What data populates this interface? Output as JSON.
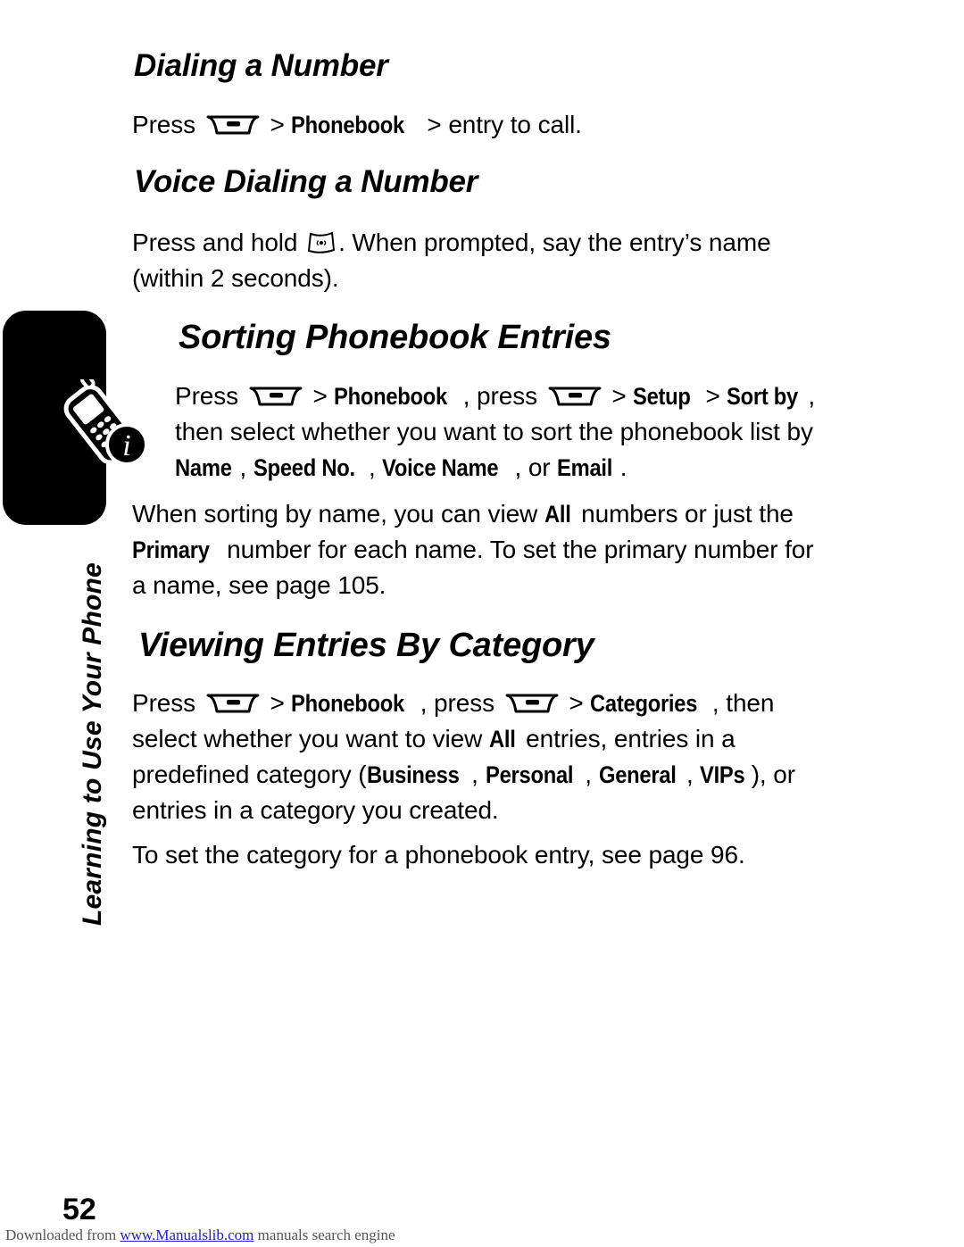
{
  "chapter": {
    "title": "Learning to Use Your Phone",
    "icon": "phone-info-icon"
  },
  "sections": [
    {
      "id": "dialing",
      "heading": "Dialing a Number",
      "paragraph": {
        "pre": "Press ",
        "key1": "menu-key-icon",
        "mid1": " > ",
        "ui1": "Phonebook",
        "mid2": " > entry to call.",
        "post": ""
      }
    },
    {
      "id": "voice-dialing",
      "heading": "Voice Dialing a Number",
      "paragraph": {
        "pre": "Press and hold ",
        "key1": "voice-key-icon",
        "post": ". When prompted, say the entry’s name (within 2 seconds)."
      }
    },
    {
      "id": "sorting",
      "heading": "Sorting Phonebook Entries",
      "paragraph": {
        "pre": "Press ",
        "key1": "menu-key-icon",
        "mid1": " > ",
        "ui1": "Phonebook",
        "mid2": ", press ",
        "key2": "menu-key-icon",
        "mid3": " > ",
        "ui2": "Setup",
        "mid4": " > ",
        "ui3": "Sort by",
        "mid5": ", then select whether you want to sort the phonebook list by ",
        "ui4": "Name",
        "mid6": ", ",
        "ui5": "Speed No.",
        "mid7": ", ",
        "ui6": "Voice Name",
        "mid8": ", or ",
        "ui7": "Email",
        "post": "."
      },
      "paragraph2": {
        "pre": "When sorting by name, you can view ",
        "ui1": "All",
        "mid1": " numbers or just the ",
        "ui2": "Primary",
        "post": " number for each name. To set the primary number for a name, see page 105."
      }
    },
    {
      "id": "viewing",
      "heading": "Viewing Entries By Category",
      "paragraph": {
        "pre": "Press ",
        "key1": "menu-key-icon",
        "mid1": " > ",
        "ui1": "Phonebook",
        "mid2": ", press ",
        "key2": "menu-key-icon",
        "mid3": " > ",
        "ui2": "Categories",
        "mid4": ", then select whether you want to view ",
        "ui3": "All",
        "mid5": " entries, entries in a predefined category (",
        "ui4": "Business",
        "mid6": ", ",
        "ui5": "Personal",
        "mid7": ", ",
        "ui6": "General",
        "mid8": ", ",
        "ui7": "VIPs",
        "post": "), or entries in a category you created."
      },
      "paragraph2": {
        "text": "To set the category for a phonebook entry, see page 96."
      }
    }
  ],
  "page_number": "52",
  "footer": {
    "pre": "Downloaded from ",
    "link": "www.Manualslib.com",
    "post": " manuals search engine"
  },
  "colors": {
    "text": "#000000",
    "tab": "#000000",
    "footer_text": "#555555",
    "link": "#2020d0",
    "background": "#ffffff"
  }
}
